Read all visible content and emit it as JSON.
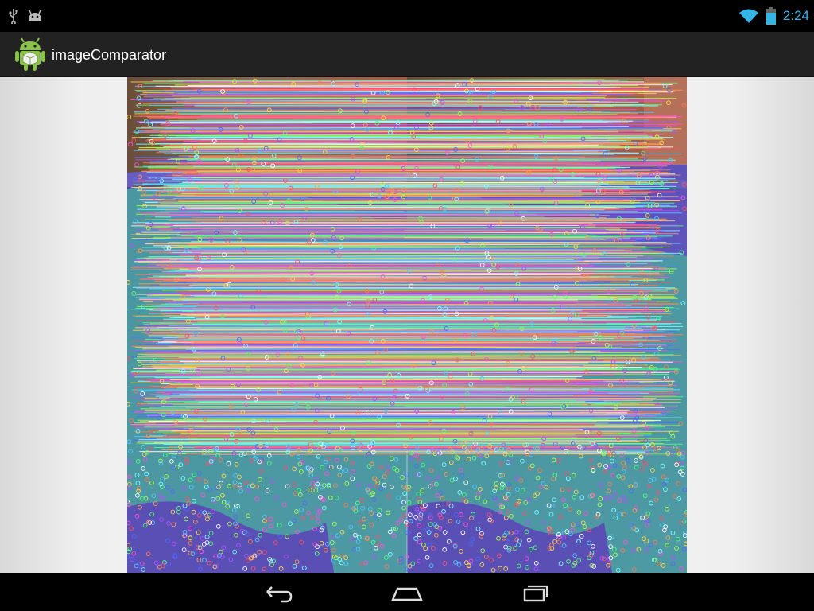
{
  "status_bar": {
    "left_icons": [
      "usb-icon",
      "android-debug-icon"
    ],
    "right_icons": [
      "wifi-icon",
      "battery-icon"
    ],
    "time": "2:24",
    "accent_color": "#33b5e5"
  },
  "action_bar": {
    "app_icon": "android-app-icon",
    "title": "imageComparator"
  },
  "content": {
    "image": "feature-match-visualization",
    "panels": [
      "left-image",
      "right-image"
    ],
    "colors": {
      "purple_plate": "#5a4fb5",
      "teal_food": "#4aa0a0",
      "top_brown": "#9a5a45"
    }
  },
  "nav_bar": {
    "buttons": [
      "back-icon",
      "home-icon",
      "recents-icon"
    ]
  }
}
